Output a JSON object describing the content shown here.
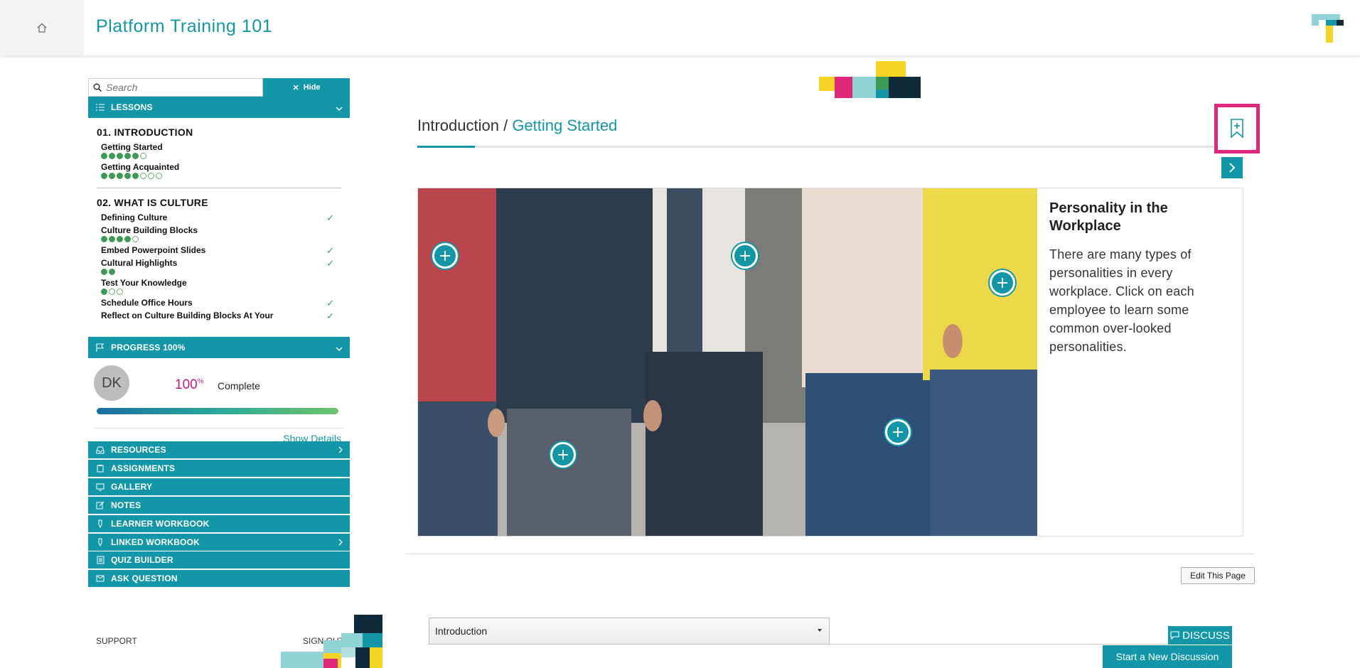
{
  "header": {
    "title": "Platform Training 101",
    "home_icon": "home-icon",
    "logo_icon": "brand-logo-icon"
  },
  "sidebar": {
    "search": {
      "placeholder": "Search",
      "value": ""
    },
    "hide_label": "Hide",
    "lessons_label": "LESSONS",
    "sections": [
      {
        "title": "01. INTRODUCTION",
        "lessons": [
          {
            "name": "Getting Started",
            "done": 5,
            "total": 6
          },
          {
            "name": "Getting Acquainted",
            "done": 5,
            "total": 8
          }
        ]
      },
      {
        "title": "02. WHAT IS CULTURE",
        "lessons": [
          {
            "name": "Defining Culture",
            "check": true
          },
          {
            "name": "Culture Building Blocks",
            "done": 4,
            "total": 5
          },
          {
            "name": "Embed Powerpoint Slides",
            "check": true
          },
          {
            "name": "Cultural Highlights",
            "done": 2,
            "total": 2,
            "check": true
          },
          {
            "name": "Test Your Knowledge",
            "done": 1,
            "total": 3
          },
          {
            "name": "Schedule Office Hours",
            "check": true
          },
          {
            "name": "Reflect on Culture Building Blocks At Your",
            "check": true
          }
        ]
      }
    ],
    "progress": {
      "label": "PROGRESS 100%",
      "initials": "DK",
      "percent": "100",
      "percent_sign": "%",
      "complete_label": "Complete",
      "fraction": 1.0,
      "show_details": "Show Details"
    },
    "menu": [
      {
        "label": "RESOURCES",
        "icon": "inbox-icon",
        "chevron": true
      },
      {
        "label": "ASSIGNMENTS",
        "icon": "clipboard-icon",
        "chevron": false
      },
      {
        "label": "GALLERY",
        "icon": "monitor-icon",
        "chevron": false
      },
      {
        "label": "NOTES",
        "icon": "edit-icon",
        "chevron": false
      },
      {
        "label": "LEARNER WORKBOOK",
        "icon": "pen-icon",
        "chevron": false
      },
      {
        "label": "LINKED WORKBOOK",
        "icon": "pen-icon",
        "chevron": true
      },
      {
        "label": "QUIZ BUILDER",
        "icon": "list-icon",
        "chevron": false
      },
      {
        "label": "ASK QUESTION",
        "icon": "mail-icon",
        "chevron": false
      }
    ],
    "support_label": "SUPPORT",
    "signout_label": "SIGN OUT"
  },
  "main": {
    "breadcrumb": {
      "parent": "Introduction",
      "separator": " / ",
      "current": "Getting Started"
    },
    "progress_fraction": 0.07,
    "panel": {
      "title": "Personality in the Workplace",
      "body": "There are many types of personalities in every workplace. Click on each employee to learn some common over-looked personalities."
    },
    "edit_label": "Edit This Page",
    "select_value": "Introduction",
    "discuss_label": "DISCUSS",
    "new_discussion_label": "Start a New Discussion"
  },
  "colors": {
    "accent": "#1396a8",
    "highlight": "#e0287a",
    "check": "#3b9b55",
    "percent": "#c2187b"
  }
}
